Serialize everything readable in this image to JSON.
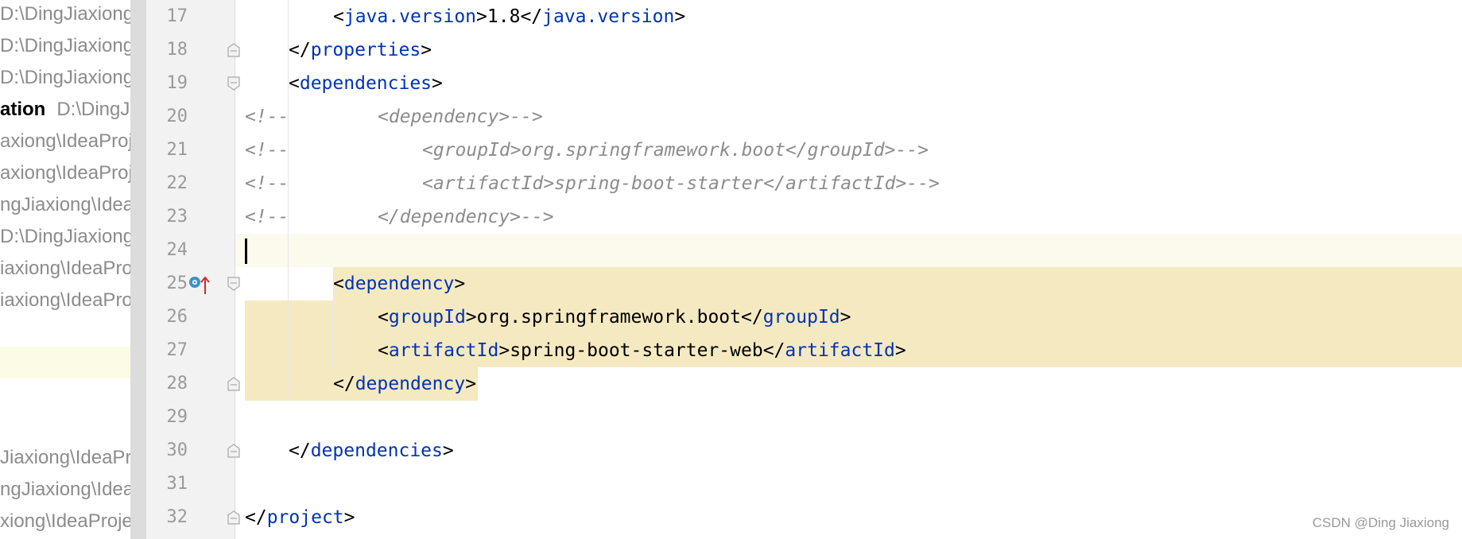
{
  "sidebar": {
    "items": [
      {
        "text": "D:\\DingJiaxiong\\"
      },
      {
        "text": "D:\\DingJiaxiong\\"
      },
      {
        "text": "D:\\DingJiaxiong\\"
      },
      {
        "bold": "ation",
        "text": "D:\\DingJia"
      },
      {
        "text": "axiong\\IdeaProje"
      },
      {
        "text": "axiong\\IdeaProje"
      },
      {
        "text": "ngJiaxiong\\IdeaP"
      },
      {
        "text": "D:\\DingJiaxiong\\"
      },
      {
        "text": "iaxiong\\IdeaProj"
      },
      {
        "text": "iaxiong\\IdeaProj"
      },
      {
        "text": "Jiaxiong\\IdeaPro"
      },
      {
        "text": "ngJiaxiong\\IdeaPr"
      },
      {
        "text": "xiong\\IdeaProjec"
      }
    ]
  },
  "editor": {
    "line_numbers": [
      "17",
      "18",
      "19",
      "20",
      "21",
      "22",
      "23",
      "24",
      "25",
      "26",
      "27",
      "28",
      "29",
      "30",
      "31",
      "32"
    ],
    "lines": {
      "l17": {
        "open": "java.version",
        "value": "1.8",
        "close": "java.version"
      },
      "l18": {
        "close": "properties"
      },
      "l19": {
        "open": "dependencies"
      },
      "l20": {
        "prefix": "<!--",
        "text": "<dependency>-->"
      },
      "l21": {
        "prefix": "<!--",
        "text": "<groupId>org.springframework.boot</groupId>-->"
      },
      "l22": {
        "prefix": "<!--",
        "text": "<artifactId>spring-boot-starter</artifactId>-->"
      },
      "l23": {
        "prefix": "<!--",
        "text": "</dependency>-->"
      },
      "l25": {
        "open": "dependency"
      },
      "l26": {
        "open": "groupId",
        "value": "org.springframework.boot",
        "close": "groupId"
      },
      "l27": {
        "open": "artifactId",
        "value": "spring-boot-starter-web",
        "close": "artifactId"
      },
      "l28": {
        "close": "dependency"
      },
      "l30": {
        "close": "dependencies"
      },
      "l32": {
        "close": "project"
      }
    },
    "colors": {
      "tag": "#0033b3",
      "comment": "#8c8c8c",
      "selection": "#f5e9c2",
      "current_line": "#fcfaed"
    }
  },
  "watermark": "CSDN @Ding Jiaxiong"
}
